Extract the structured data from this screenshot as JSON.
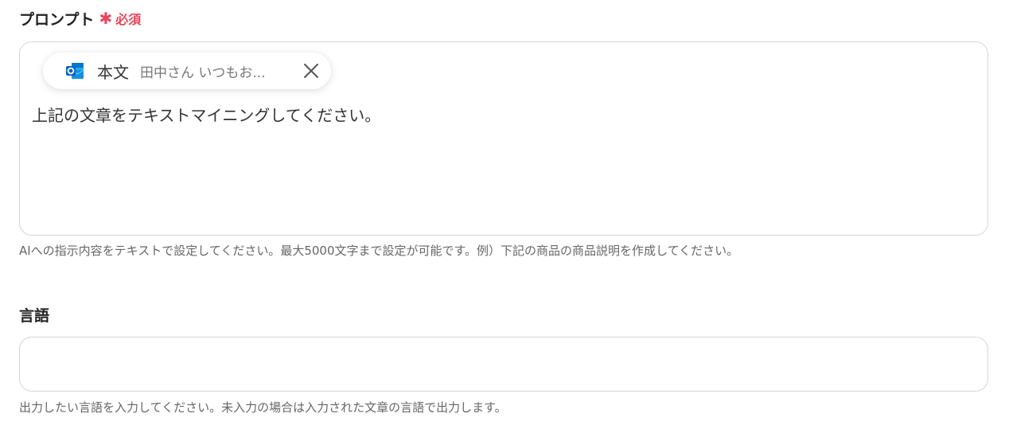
{
  "prompt": {
    "label": "プロンプト",
    "required_mark": "✱",
    "required_text": "必須",
    "chip": {
      "icon": "outlook-icon",
      "title": "本文",
      "preview": "田中さん いつもお..."
    },
    "value": "上記の文章をテキストマイニングしてください。",
    "help": "AIへの指示内容をテキストで設定してください。最大5000文字まで設定が可能です。例）下記の商品の商品説明を作成してください。"
  },
  "language": {
    "label": "言語",
    "value": "",
    "help": "出力したい言語を入力してください。未入力の場合は入力された文章の言語で出力します。"
  },
  "colors": {
    "required": "#e8455b",
    "outlook_blue": "#0a64c8"
  }
}
